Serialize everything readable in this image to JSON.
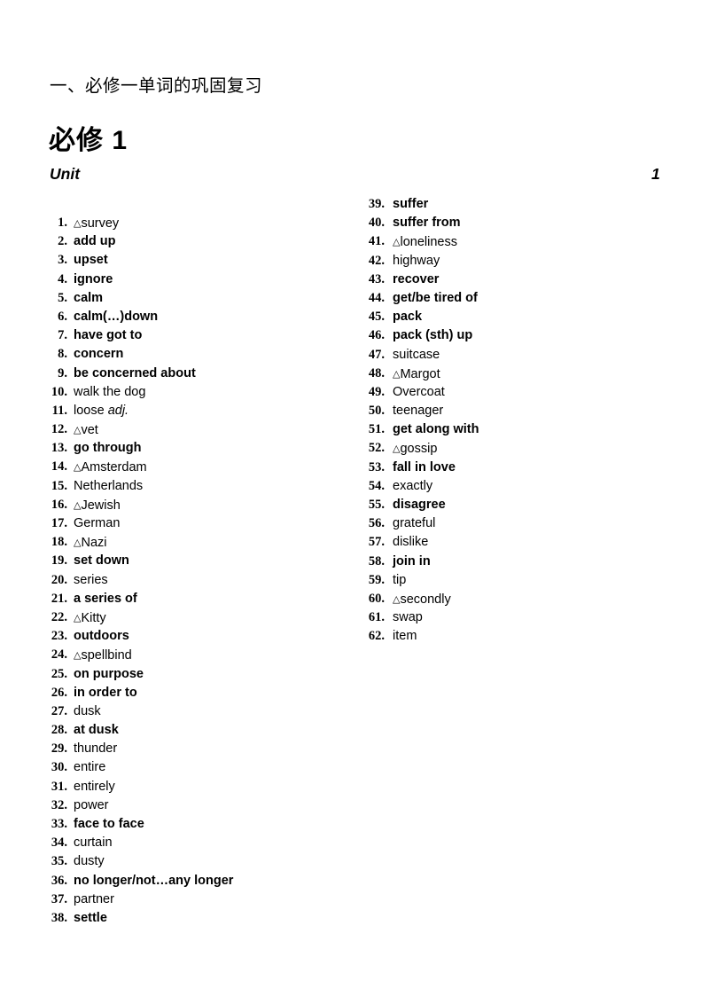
{
  "document": {
    "section_heading": "一、必修一单词的巩固复习",
    "book_heading": "必修 1",
    "unit": {
      "label": "Unit",
      "number": "1"
    },
    "marker_glyph": "△",
    "colors": {
      "page_background": "#ffffff",
      "text": "#000000"
    }
  },
  "vocabulary": {
    "left_column": [
      {
        "num": "1.",
        "marker": "△",
        "word": "survey",
        "suffix": "",
        "bold": false
      },
      {
        "num": "2.",
        "marker": "",
        "word": "add up",
        "suffix": "",
        "bold": true
      },
      {
        "num": "3.",
        "marker": "",
        "word": "upset",
        "suffix": "",
        "bold": true
      },
      {
        "num": "4.",
        "marker": "",
        "word": "ignore",
        "suffix": "",
        "bold": true
      },
      {
        "num": "5.",
        "marker": "",
        "word": "calm",
        "suffix": "",
        "bold": true
      },
      {
        "num": "6.",
        "marker": "",
        "word": "calm(…)down",
        "suffix": "",
        "bold": true
      },
      {
        "num": "7.",
        "marker": "",
        "word": "have got to",
        "suffix": "",
        "bold": true
      },
      {
        "num": "8.",
        "marker": "",
        "word": "concern",
        "suffix": "",
        "bold": true
      },
      {
        "num": "9.",
        "marker": "",
        "word": "be concerned about",
        "suffix": "",
        "bold": true
      },
      {
        "num": "10.",
        "marker": "",
        "word": "walk the dog",
        "suffix": "",
        "bold": false
      },
      {
        "num": "11.",
        "marker": "",
        "word": "loose ",
        "suffix": "adj.",
        "bold": false
      },
      {
        "num": "12.",
        "marker": "△",
        "word": "vet",
        "suffix": "",
        "bold": false
      },
      {
        "num": "13.",
        "marker": "",
        "word": "go through",
        "suffix": "",
        "bold": true
      },
      {
        "num": "14.",
        "marker": "△",
        "word": "Amsterdam",
        "suffix": "",
        "bold": false
      },
      {
        "num": "15.",
        "marker": "",
        "word": "Netherlands",
        "suffix": "",
        "bold": false
      },
      {
        "num": "16.",
        "marker": "△",
        "word": "Jewish",
        "suffix": "",
        "bold": false
      },
      {
        "num": "17.",
        "marker": "",
        "word": "German",
        "suffix": "",
        "bold": false
      },
      {
        "num": "18.",
        "marker": "△",
        "word": "Nazi",
        "suffix": "",
        "bold": false
      },
      {
        "num": "19.",
        "marker": "",
        "word": "set down",
        "suffix": "",
        "bold": true
      },
      {
        "num": "20.",
        "marker": "",
        "word": "series",
        "suffix": "",
        "bold": false
      },
      {
        "num": "21.",
        "marker": "",
        "word": "a series of",
        "suffix": "",
        "bold": true
      },
      {
        "num": "22.",
        "marker": "△",
        "word": "Kitty",
        "suffix": "",
        "bold": false
      },
      {
        "num": "23.",
        "marker": "",
        "word": "outdoors",
        "suffix": "",
        "bold": true
      },
      {
        "num": "24.",
        "marker": "△",
        "word": "spellbind",
        "suffix": "",
        "bold": false
      },
      {
        "num": "25.",
        "marker": "",
        "word": "on purpose",
        "suffix": "",
        "bold": true
      },
      {
        "num": "26.",
        "marker": "",
        "word": "in order to",
        "suffix": "",
        "bold": true
      },
      {
        "num": "27.",
        "marker": "",
        "word": "dusk",
        "suffix": "",
        "bold": false
      },
      {
        "num": "28.",
        "marker": "",
        "word": "at dusk",
        "suffix": "",
        "bold": true
      },
      {
        "num": "29.",
        "marker": "",
        "word": "thunder",
        "suffix": "",
        "bold": false
      },
      {
        "num": "30.",
        "marker": "",
        "word": "entire",
        "suffix": "",
        "bold": false
      },
      {
        "num": "31.",
        "marker": "",
        "word": "entirely",
        "suffix": "",
        "bold": false
      },
      {
        "num": "32.",
        "marker": "",
        "word": "power",
        "suffix": "",
        "bold": false
      },
      {
        "num": "33.",
        "marker": "",
        "word": "face to face",
        "suffix": "",
        "bold": true
      },
      {
        "num": "34.",
        "marker": "",
        "word": "curtain",
        "suffix": "",
        "bold": false
      },
      {
        "num": "35.",
        "marker": "",
        "word": "dusty",
        "suffix": "",
        "bold": false
      },
      {
        "num": "36.",
        "marker": "",
        "word": "no longer/not…any longer",
        "suffix": "",
        "bold": true
      },
      {
        "num": "37.",
        "marker": "",
        "word": "partner",
        "suffix": "",
        "bold": false
      },
      {
        "num": "38.",
        "marker": "",
        "word": "settle",
        "suffix": "",
        "bold": true
      }
    ],
    "right_column": [
      {
        "num": "39.",
        "marker": "",
        "word": "suffer",
        "suffix": "",
        "bold": true
      },
      {
        "num": "40.",
        "marker": "",
        "word": "suffer from",
        "suffix": "",
        "bold": true
      },
      {
        "num": "41.",
        "marker": "△",
        "word": "loneliness",
        "suffix": "",
        "bold": false
      },
      {
        "num": "42.",
        "marker": "",
        "word": "highway",
        "suffix": "",
        "bold": false
      },
      {
        "num": "43.",
        "marker": "",
        "word": "recover",
        "suffix": "",
        "bold": true
      },
      {
        "num": "44.",
        "marker": "",
        "word": "get/be tired of",
        "suffix": "",
        "bold": true
      },
      {
        "num": "45.",
        "marker": "",
        "word": "pack",
        "suffix": "",
        "bold": true
      },
      {
        "num": "46.",
        "marker": "",
        "word": "pack (sth) up",
        "suffix": "",
        "bold": true
      },
      {
        "num": "47.",
        "marker": "",
        "word": "suitcase",
        "suffix": "",
        "bold": false
      },
      {
        "num": "48.",
        "marker": "△",
        "word": "Margot",
        "suffix": "",
        "bold": false
      },
      {
        "num": "49.",
        "marker": "",
        "word": "Overcoat",
        "suffix": "",
        "bold": false
      },
      {
        "num": "50.",
        "marker": "",
        "word": "teenager",
        "suffix": "",
        "bold": false
      },
      {
        "num": "51.",
        "marker": "",
        "word": "get along with",
        "suffix": "",
        "bold": true
      },
      {
        "num": "52.",
        "marker": "△",
        "word": "gossip",
        "suffix": "",
        "bold": false
      },
      {
        "num": "53.",
        "marker": "",
        "word": "fall in love",
        "suffix": "",
        "bold": true
      },
      {
        "num": "54.",
        "marker": "",
        "word": "exactly",
        "suffix": "",
        "bold": false
      },
      {
        "num": "55.",
        "marker": "",
        "word": "disagree",
        "suffix": "",
        "bold": true
      },
      {
        "num": "56.",
        "marker": "",
        "word": "grateful",
        "suffix": "",
        "bold": false
      },
      {
        "num": "57.",
        "marker": "",
        "word": "dislike",
        "suffix": "",
        "bold": false
      },
      {
        "num": "58.",
        "marker": "",
        "word": "join in",
        "suffix": "",
        "bold": true
      },
      {
        "num": "59.",
        "marker": "",
        "word": "tip",
        "suffix": "",
        "bold": false
      },
      {
        "num": "60.",
        "marker": "△",
        "word": "secondly",
        "suffix": "",
        "bold": false
      },
      {
        "num": "61.",
        "marker": "",
        "word": "swap",
        "suffix": "",
        "bold": false
      },
      {
        "num": "62.",
        "marker": "",
        "word": "item",
        "suffix": "",
        "bold": false
      }
    ]
  }
}
